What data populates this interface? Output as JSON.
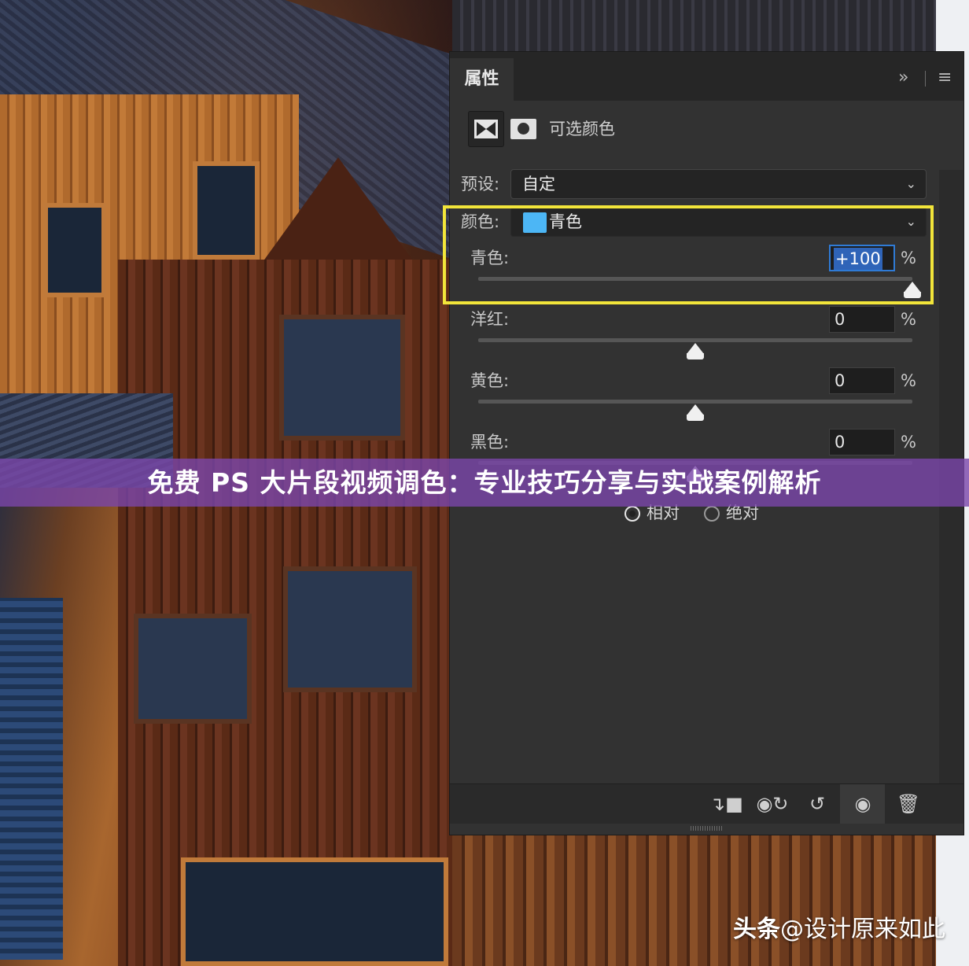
{
  "panel": {
    "tab_label": "属性",
    "adjustment_title": "可选颜色",
    "preset_label": "预设:",
    "preset_value": "自定",
    "color_label": "颜色:",
    "color_value": "青色",
    "color_swatch": "#4cb6f5",
    "sliders": [
      {
        "label": "青色:",
        "value": "+100",
        "percent": "%",
        "level": 1.0
      },
      {
        "label": "洋红:",
        "value": "0",
        "percent": "%",
        "level": 0.5
      },
      {
        "label": "黄色:",
        "value": "0",
        "percent": "%",
        "level": 0.5
      },
      {
        "label": "黑色:",
        "value": "0",
        "percent": "%",
        "level": 0.5
      }
    ],
    "method_options": [
      {
        "label": "相对",
        "selected": true
      },
      {
        "label": "绝对",
        "selected": false
      }
    ],
    "icons": {
      "expand": "double-chevron-right-icon",
      "menu": "hamburger-menu-icon",
      "clip": "clip-to-layer-icon",
      "view_previous": "view-previous-state-icon",
      "reset": "reset-icon",
      "visibility": "eye-icon",
      "delete": "trash-icon"
    },
    "highlight_color": "#f2e53a"
  },
  "banner": {
    "title": "免费 PS 大片段视频调色：专业技巧分享与实战案例解析"
  },
  "watermark": {
    "brand": "头条",
    "handle": "@设计原来如此"
  }
}
